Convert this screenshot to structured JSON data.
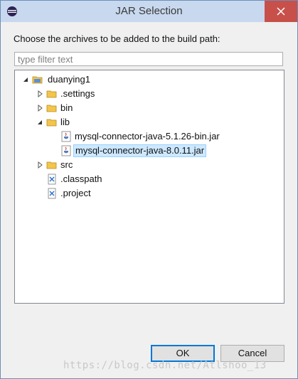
{
  "window": {
    "title": "JAR Selection"
  },
  "instructions": "Choose the archives to be added to the build path:",
  "filter": {
    "placeholder": "type filter text",
    "value": ""
  },
  "tree": [
    {
      "label": "duanying1",
      "icon": "project-folder-icon",
      "expanded": true,
      "depth": 0
    },
    {
      "label": ".settings",
      "icon": "folder-icon",
      "expanded": false,
      "depth": 1
    },
    {
      "label": "bin",
      "icon": "folder-icon",
      "expanded": false,
      "depth": 1
    },
    {
      "label": "lib",
      "icon": "folder-icon",
      "expanded": true,
      "depth": 1
    },
    {
      "label": "mysql-connector-java-5.1.26-bin.jar",
      "icon": "jar-icon",
      "depth": 2
    },
    {
      "label": "mysql-connector-java-8.0.11.jar",
      "icon": "jar-icon",
      "depth": 2,
      "selected": true
    },
    {
      "label": "src",
      "icon": "folder-icon",
      "expanded": false,
      "depth": 1
    },
    {
      "label": ".classpath",
      "icon": "xml-file-icon",
      "depth": 1
    },
    {
      "label": ".project",
      "icon": "xml-file-icon",
      "depth": 1
    }
  ],
  "buttons": {
    "ok": "OK",
    "cancel": "Cancel"
  },
  "watermark": "https://blog.csdn.net/Atlshoo_13",
  "colors": {
    "titlebar": "#c8d8ee",
    "close": "#c7504b",
    "selection": "#cce8ff",
    "default_button_border": "#0078d7"
  }
}
